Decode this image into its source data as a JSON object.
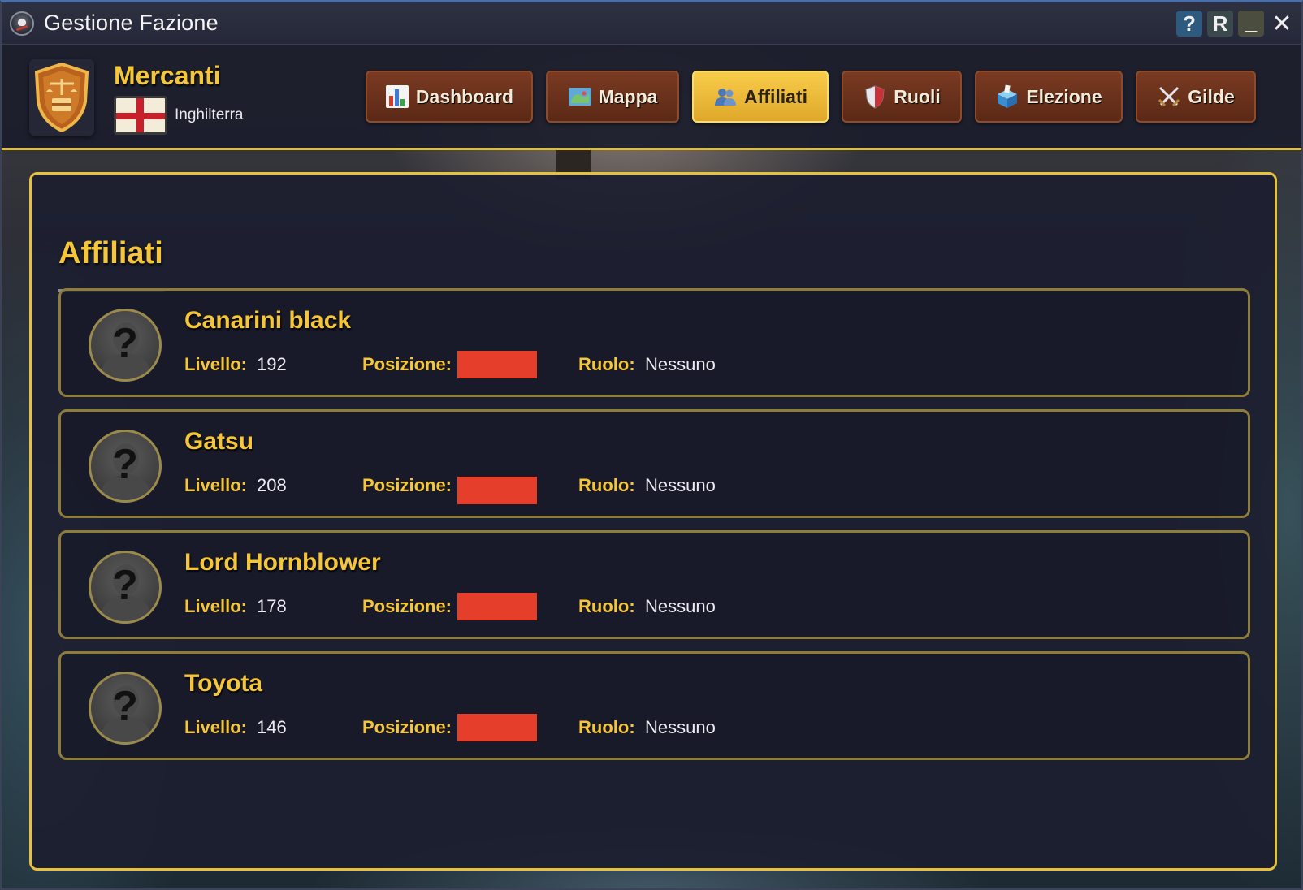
{
  "window": {
    "title": "Gestione Fazione",
    "controls": {
      "help_label": "?",
      "refresh_label": "R",
      "minimize_label": "_",
      "close_label": "✕"
    }
  },
  "header": {
    "faction_name": "Mercanti",
    "country": "Inghilterra",
    "emblem_icon": "merchant-shield-icon",
    "flag_icon": "england-flag-icon",
    "accent_color": "#e2bd3a",
    "tabs": [
      {
        "label": "Dashboard",
        "icon": "bar-chart-icon",
        "active": false
      },
      {
        "label": "Mappa",
        "icon": "map-icon",
        "active": false
      },
      {
        "label": "Affiliati",
        "icon": "people-icon",
        "active": true
      },
      {
        "label": "Ruoli",
        "icon": "shield-icon",
        "active": false
      },
      {
        "label": "Elezione",
        "icon": "ballot-box-icon",
        "active": false
      },
      {
        "label": "Gilde",
        "icon": "crossed-swords-icon",
        "active": false
      }
    ]
  },
  "main": {
    "title": "Affiliati",
    "labels": {
      "level": "Livello:",
      "position": "Posizione:",
      "role": "Ruolo:"
    },
    "members": [
      {
        "name": "Canarini black",
        "level": "192",
        "position_color": "#e53e2a",
        "role": "Nessuno"
      },
      {
        "name": "Gatsu",
        "level": "208",
        "position_color": "#e53e2a",
        "role": "Nessuno"
      },
      {
        "name": "Lord Hornblower",
        "level": "178",
        "position_color": "#e53e2a",
        "role": "Nessuno"
      },
      {
        "name": "Toyota",
        "level": "146",
        "position_color": "#e53e2a",
        "role": "Nessuno"
      }
    ]
  }
}
